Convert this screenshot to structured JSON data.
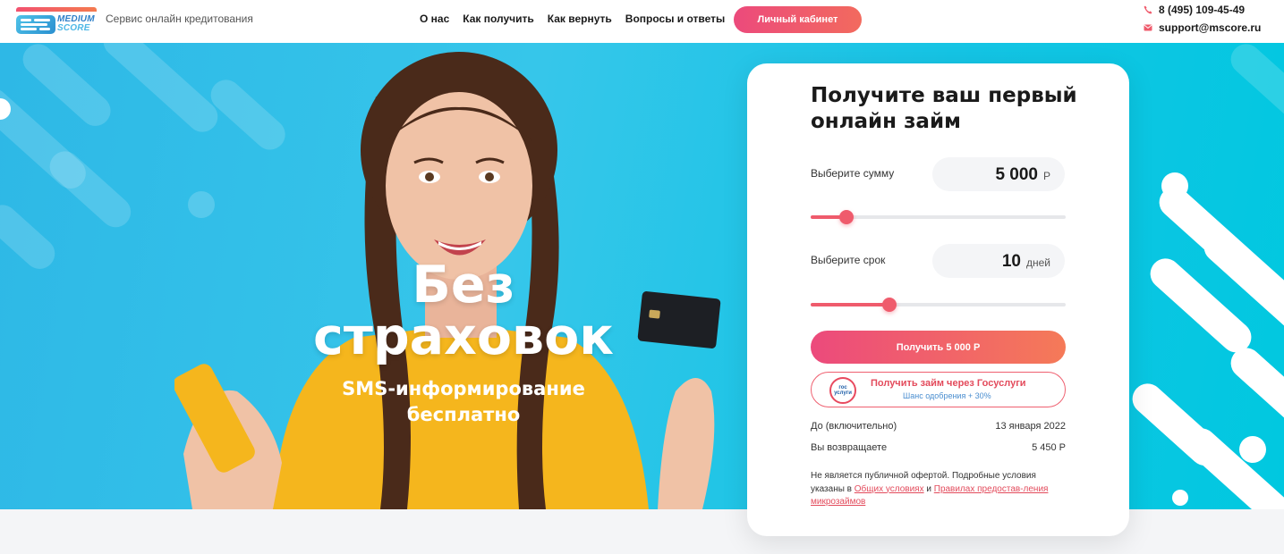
{
  "header": {
    "logo_line1": "MEDIUM",
    "logo_line2": "SCORE",
    "tagline": "Сервис онлайн кредитования",
    "nav": [
      "О нас",
      "Как получить",
      "Как вернуть",
      "Вопросы и ответы"
    ],
    "cabinet_button": "Личный кабинет",
    "phone": "8 (495) 109-45-49",
    "email": "support@mscore.ru"
  },
  "hero": {
    "title": "Без страховок",
    "subtitle": "SMS-информирование бесплатно"
  },
  "loan_form": {
    "title": "Получите ваш первый онлайн займ",
    "amount_label": "Выберите сумму",
    "amount_value": "5 000",
    "amount_unit": "Р",
    "amount_slider_fraction": 0.14,
    "term_label": "Выберите срок",
    "term_value": "10",
    "term_unit": "дней",
    "term_slider_fraction": 0.31,
    "submit_button": "Получить 5 000 Р",
    "gosuslugi_button": "Получить займ через Госуслуги",
    "gosuslugi_note": "Шанс одобрения + 30%",
    "gosuslugi_logo_line1": "гос",
    "gosuslugi_logo_line2": "услуги",
    "due_label": "До (включительно)",
    "due_value": "13 января 2022",
    "repay_label": "Вы возвращаете",
    "repay_value": "5 450 Р",
    "disclaimer_text": "Не является публичной офертой. Подробные условия указаны в",
    "disclaimer_link1": "Общих условиях",
    "disclaimer_and": "и",
    "disclaimer_link2": "Правилах предостав-ления микрозаймов"
  },
  "colors": {
    "accent": "#ef5b6c",
    "hero_bg": "#2eb8e6",
    "brand_blue": "#2f80c9"
  }
}
